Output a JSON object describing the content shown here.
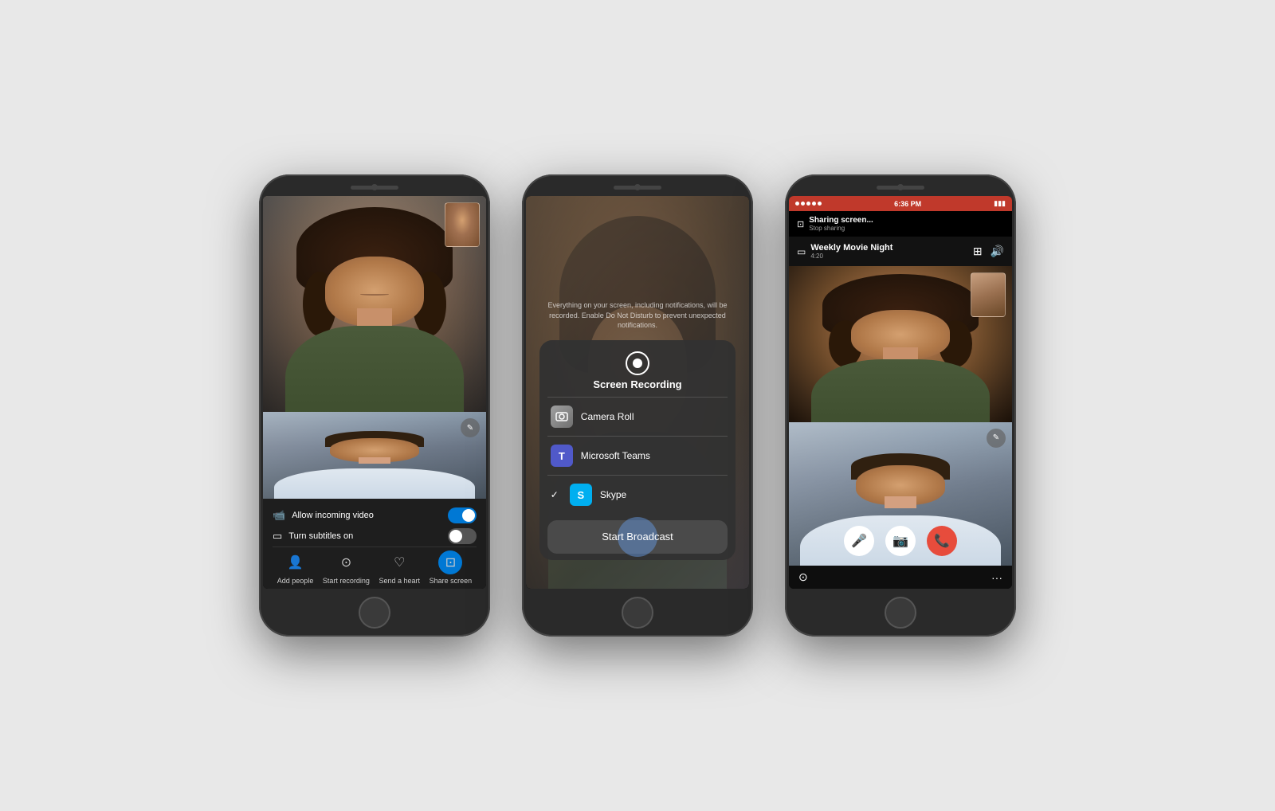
{
  "bg_color": "#e8e8e8",
  "phones": [
    {
      "id": "phone1",
      "label": "Skype call with controls",
      "controls": {
        "toggle1_label": "Allow incoming video",
        "toggle1_on": true,
        "toggle2_label": "Turn subtitles on",
        "toggle2_on": false,
        "actions": [
          {
            "id": "add-people",
            "label": "Add people",
            "icon": "👤",
            "active": false
          },
          {
            "id": "start-recording",
            "label": "Start recording",
            "icon": "⊙",
            "active": false
          },
          {
            "id": "send-heart",
            "label": "Send a heart",
            "icon": "♡",
            "active": false
          },
          {
            "id": "share-screen",
            "label": "Share screen",
            "icon": "⊡",
            "active": true
          }
        ]
      }
    },
    {
      "id": "phone2",
      "label": "iOS Screen recording share sheet",
      "hint_text": "Everything on your screen, including notifications, will be recorded. Enable Do Not Disturb to prevent unexpected notifications.",
      "recording_title": "Screen Recording",
      "options": [
        {
          "id": "camera-roll",
          "label": "Camera Roll",
          "icon": "📷",
          "icon_bg": "#888",
          "selected": false
        },
        {
          "id": "microsoft-teams",
          "label": "Microsoft Teams",
          "icon": "T",
          "icon_bg": "#5059c9",
          "selected": false
        },
        {
          "id": "skype",
          "label": "Skype",
          "icon": "S",
          "icon_bg": "#00aff0",
          "selected": true
        }
      ],
      "broadcast_btn": "Start Broadcast"
    },
    {
      "id": "phone3",
      "label": "Skype call with screen sharing active",
      "status_bar": {
        "dots": 5,
        "time": "6:36 PM",
        "battery": "▮▮▮"
      },
      "sharing_banner": {
        "title": "Sharing screen...",
        "subtitle": "Stop sharing"
      },
      "call_header": {
        "title": "Weekly Movie Night",
        "duration": "4:20"
      },
      "controls": [
        {
          "id": "mute",
          "icon": "🎤",
          "type": "white"
        },
        {
          "id": "video",
          "icon": "📷",
          "type": "white"
        },
        {
          "id": "end-call",
          "icon": "📞",
          "type": "red"
        }
      ]
    }
  ]
}
